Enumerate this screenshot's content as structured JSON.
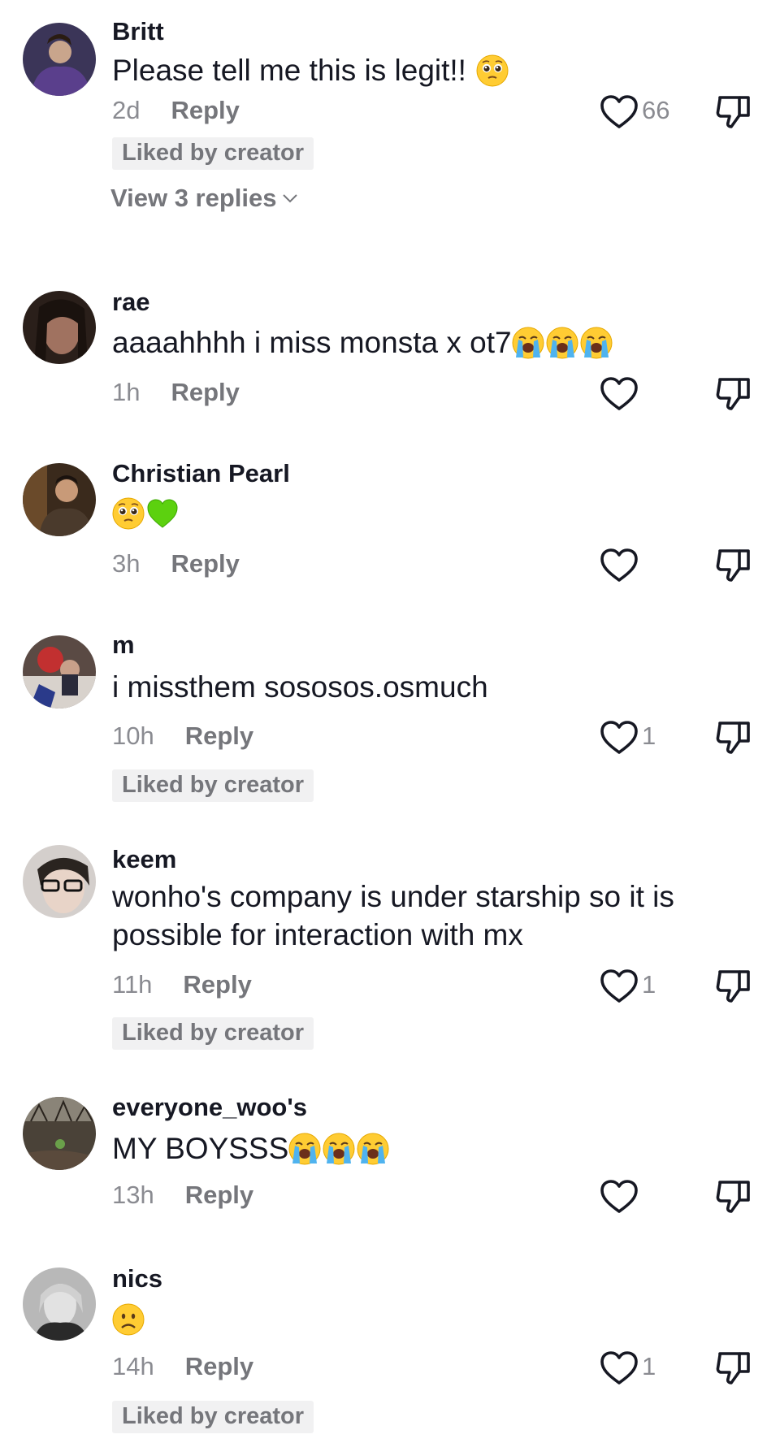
{
  "comments": [
    {
      "username": "Britt",
      "text": "Please tell me this is legit!!",
      "emojis": [
        "pleading"
      ],
      "time": "2d",
      "reply_label": "Reply",
      "likes": "66",
      "liked_by_creator": "Liked by creator",
      "view_replies": "View 3 replies"
    },
    {
      "username": "rae",
      "text": "aaaahhhh i miss monsta x ot7",
      "emojis": [
        "crying",
        "crying",
        "crying"
      ],
      "time": "1h",
      "reply_label": "Reply",
      "likes": ""
    },
    {
      "username": "Christian Pearl",
      "text": "",
      "emojis": [
        "pleading",
        "green-heart"
      ],
      "time": "3h",
      "reply_label": "Reply",
      "likes": ""
    },
    {
      "username": "m",
      "text": "i missthem sososos.osmuch",
      "time": "10h",
      "reply_label": "Reply",
      "likes": "1",
      "liked_by_creator": "Liked by creator"
    },
    {
      "username": "keem",
      "text": "wonho's company is under starship so it is possible for interaction with mx",
      "time": "11h",
      "reply_label": "Reply",
      "likes": "1",
      "liked_by_creator": "Liked by creator"
    },
    {
      "username": "everyone_woo's",
      "text": "MY BOYSSS",
      "emojis": [
        "crying",
        "crying",
        "crying"
      ],
      "time": "13h",
      "reply_label": "Reply",
      "likes": ""
    },
    {
      "username": "nics",
      "text": "",
      "emojis": [
        "frowning"
      ],
      "time": "14h",
      "reply_label": "Reply",
      "likes": "1",
      "liked_by_creator": "Liked by creator"
    }
  ],
  "icons": {
    "like": "heart-outline-icon",
    "dislike": "thumbs-down-icon",
    "expand": "chevron-down-icon"
  },
  "colors": {
    "username": "#161823",
    "meta": "#8a8b91",
    "badge_bg": "#f1f1f2"
  }
}
